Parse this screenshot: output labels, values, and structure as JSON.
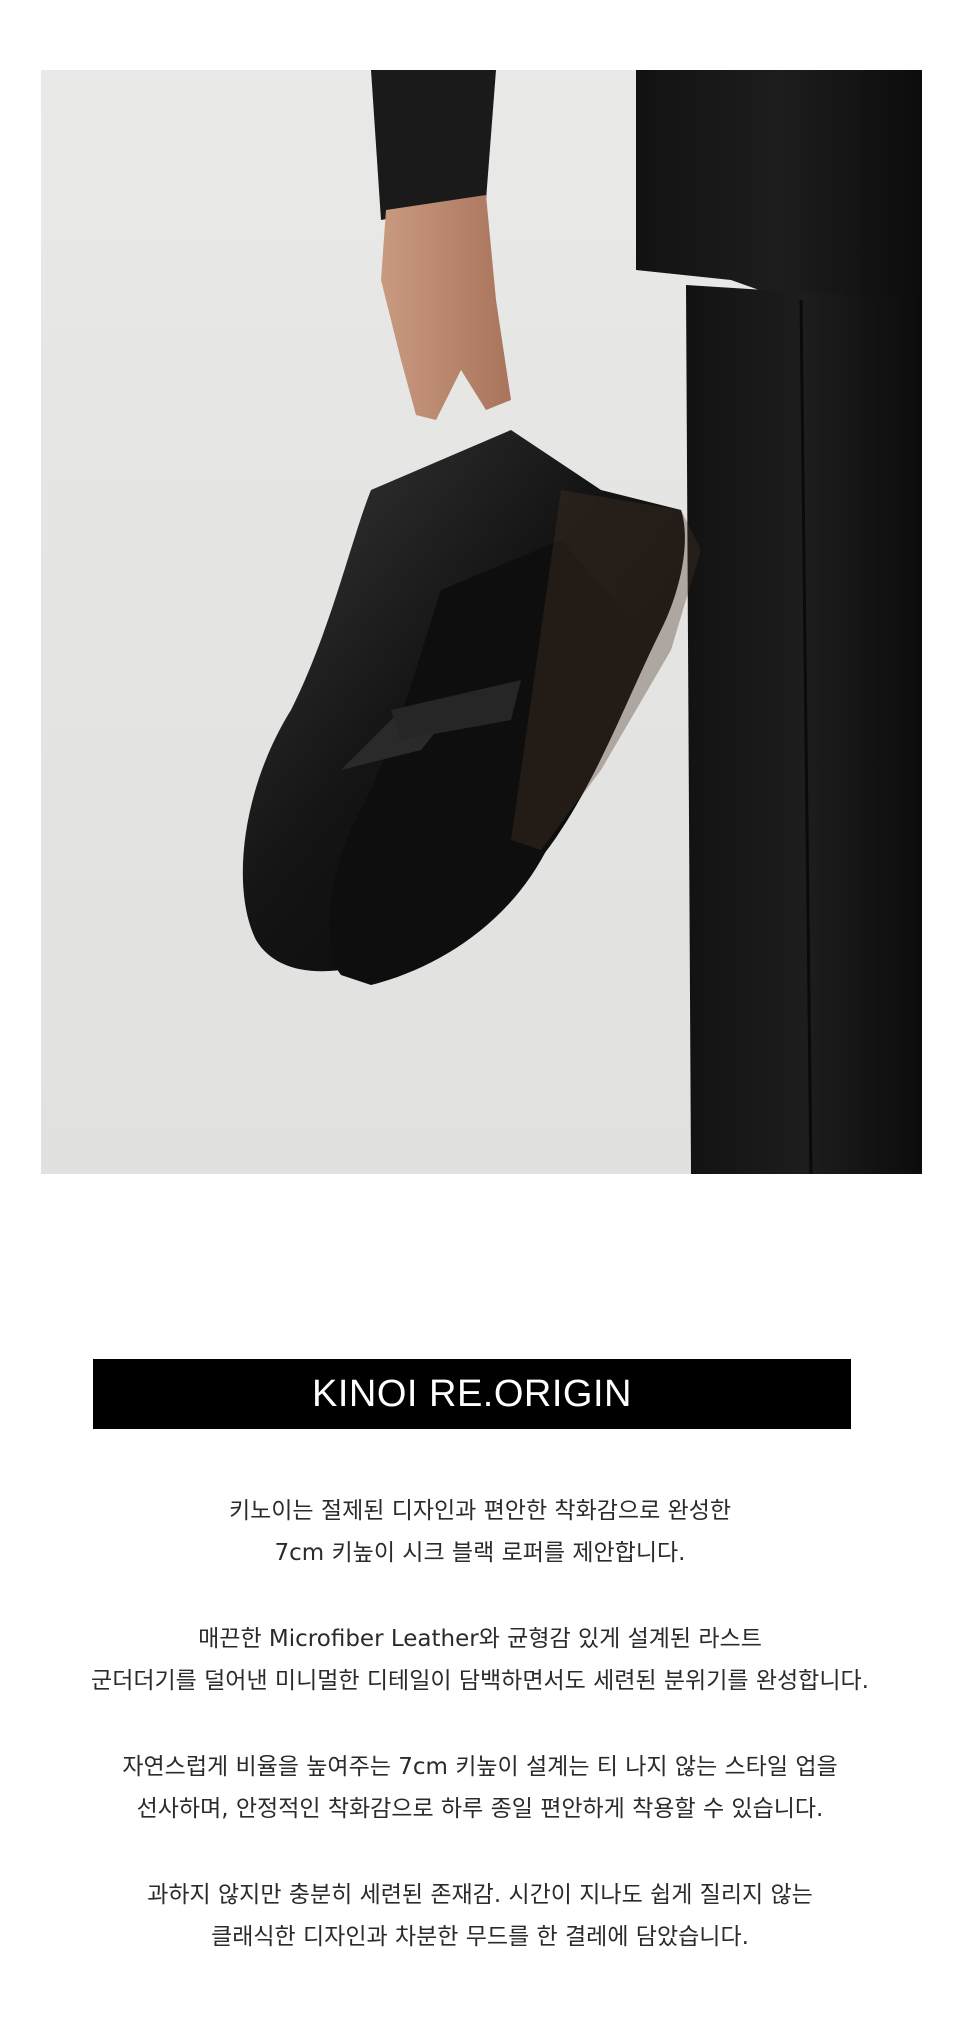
{
  "hero": {
    "alt": "hand holding black penny loafers"
  },
  "banner": {
    "title": "KINOI RE.ORIGIN"
  },
  "description": {
    "paragraphs": [
      [
        "키노이는 절제된 디자인과 편안한 착화감으로 완성한",
        "7cm 키높이 시크 블랙 로퍼를 제안합니다."
      ],
      [
        "매끈한 Microfiber Leather와 균형감 있게 설계된 라스트",
        "군더더기를 덜어낸 미니멀한 디테일이 담백하면서도 세련된 분위기를 완성합니다."
      ],
      [
        "자연스럽게 비율을 높여주는 7cm 키높이 설계는 티 나지 않는 스타일 업을",
        "선사하며, 안정적인 착화감으로 하루 종일 편안하게 착용할 수 있습니다."
      ],
      [
        "과하지 않지만 충분히 세련된 존재감. 시간이 지나도 쉽게 질리지 않는",
        "클래식한 디자인과 차분한 무드를 한 결레에 담았습니다."
      ]
    ]
  },
  "colors": {
    "banner_bg": "#000000",
    "banner_text": "#ffffff",
    "body_text": "#2b2b2b"
  }
}
